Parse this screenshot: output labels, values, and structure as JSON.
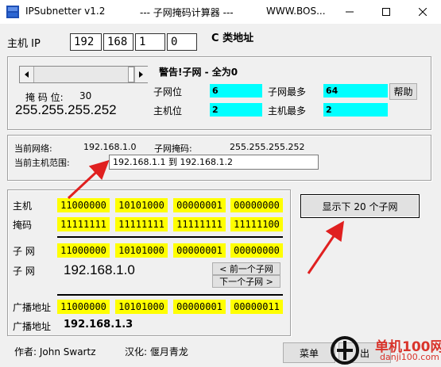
{
  "titlebar": {
    "app_name": "IPSubnetter v1.2",
    "subtitle": "--- 子网掩码计算器 ---",
    "website": "WWW.BOS..."
  },
  "host_ip": {
    "label": "主机 IP",
    "octets": [
      "192",
      "168",
      "1",
      "0"
    ],
    "ip_class": "C 类地址"
  },
  "mask": {
    "bits_label": "掩 码 位:",
    "bits_value": "30",
    "mask_value": "255.255.255.252",
    "warning": "警告!子网 - 全为0"
  },
  "info": {
    "subnet_bits_label": "子网位",
    "subnet_bits_value": "6",
    "max_subnets_label": "子网最多",
    "max_subnets_value": "64",
    "host_bits_label": "主机位",
    "host_bits_value": "2",
    "max_hosts_label": "主机最多",
    "max_hosts_value": "2",
    "help_button": "帮助"
  },
  "current": {
    "network_label": "当前网络:",
    "network_value": "192.168.1.0",
    "submask_label": "子网掩码:",
    "submask_value": "255.255.255.252",
    "host_range_label": "当前主机范围:",
    "host_range_value": "192.168.1.1  到 192.168.1.2"
  },
  "binary": {
    "host_label": "主机",
    "host_bits": [
      "11000000",
      "10101000",
      "00000001",
      "00000000"
    ],
    "mask_label": "掩码",
    "mask_bits": [
      "11111111",
      "11111111",
      "11111111",
      "11111100"
    ],
    "subnet_label": "子 网",
    "subnet_bits": [
      "11000000",
      "10101000",
      "00000001",
      "00000000"
    ],
    "subnet_label2": "子 网",
    "subnet_ip": "192.168.1.0",
    "prev_subnet_button": "< 前一个子网",
    "next_subnet_button": "下一个子网 >",
    "broadcast_label": "广播地址",
    "broadcast_bits": [
      "11000000",
      "10101000",
      "00000001",
      "00000011"
    ],
    "broadcast_label2": "广播地址",
    "broadcast_ip": "192.168.1.3"
  },
  "show_next_button": "显示下 20 个子网",
  "footer": {
    "author": "作者: John Swartz",
    "localizer": "汉化: 偃月青龙",
    "menu_button": "菜单",
    "exit_button": "出"
  },
  "watermark": {
    "text1": "单机100网",
    "text2": "danji100.com"
  },
  "colors": {
    "yellow": "#ffff00",
    "cyan": "#00ffff",
    "arrow_red": "#e02020",
    "watermark_red": "#d9342b"
  }
}
